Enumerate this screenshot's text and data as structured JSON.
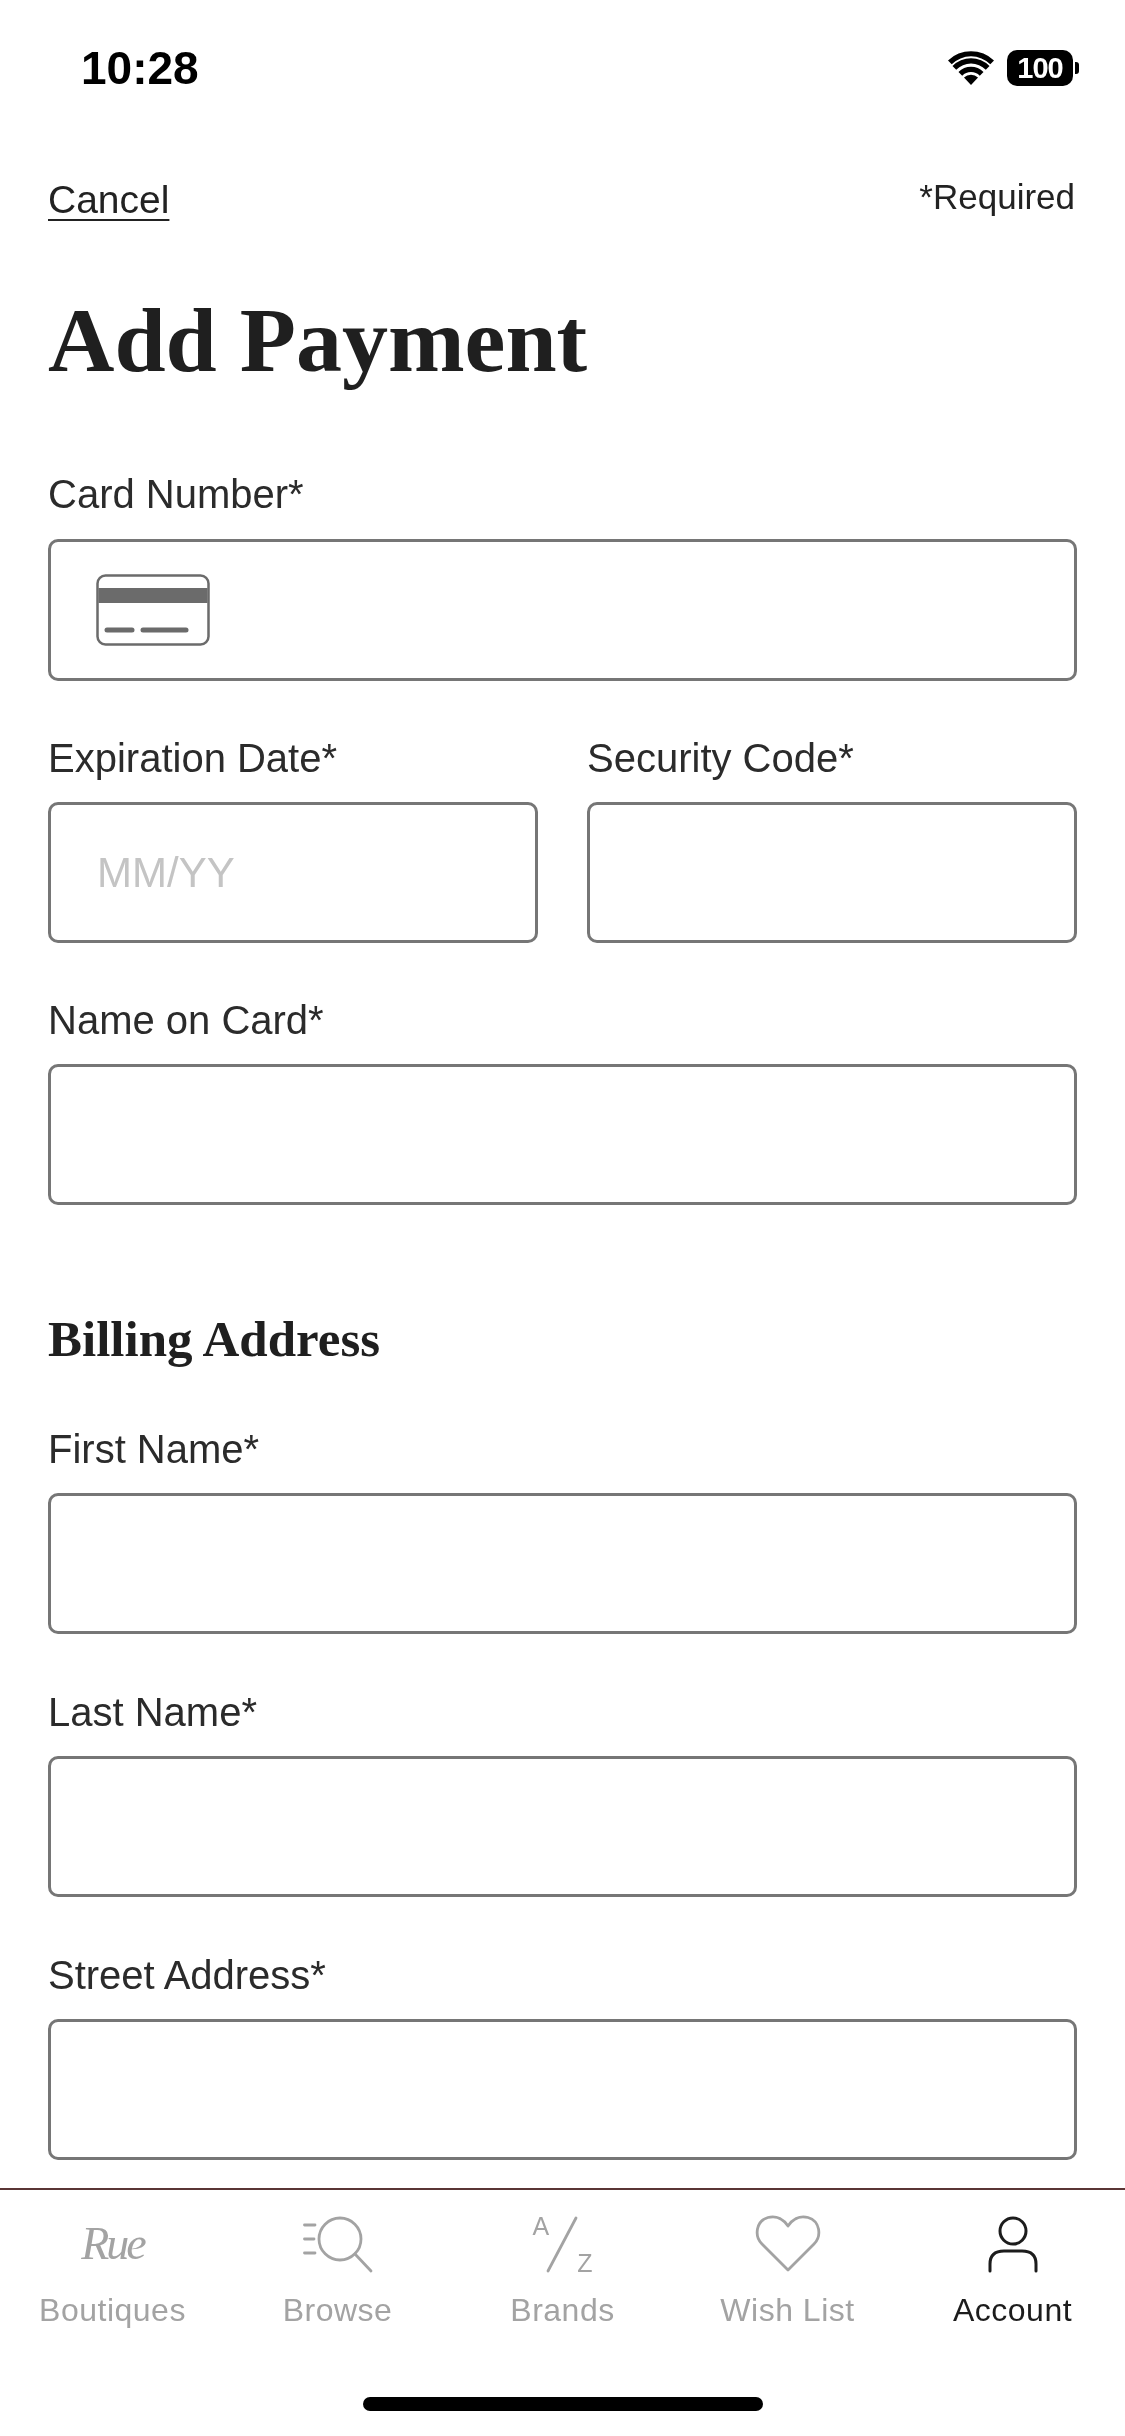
{
  "status_bar": {
    "time": "10:28",
    "battery": "100"
  },
  "header": {
    "cancel": "Cancel",
    "required_note": "*Required"
  },
  "title": "Add Payment",
  "card_number": {
    "label": "Card Number*"
  },
  "expiration_date": {
    "label": "Expiration Date*",
    "placeholder": "MM/YY"
  },
  "security_code": {
    "label": "Security Code*"
  },
  "name_on_card": {
    "label": "Name on Card*"
  },
  "billing_address": {
    "heading": "Billing Address",
    "fields": [
      {
        "label": "First Name*"
      },
      {
        "label": "Last Name*"
      },
      {
        "label": "Street Address*"
      }
    ]
  },
  "tab_bar": {
    "tabs": [
      {
        "label": "Boutiques",
        "selected": false,
        "icon_text": "Rue"
      },
      {
        "label": "Browse",
        "selected": false
      },
      {
        "label": "Brands",
        "selected": false,
        "icon_letters": [
          "A",
          "Z"
        ]
      },
      {
        "label": "Wish List",
        "selected": false
      },
      {
        "label": "Account",
        "selected": true
      }
    ]
  }
}
